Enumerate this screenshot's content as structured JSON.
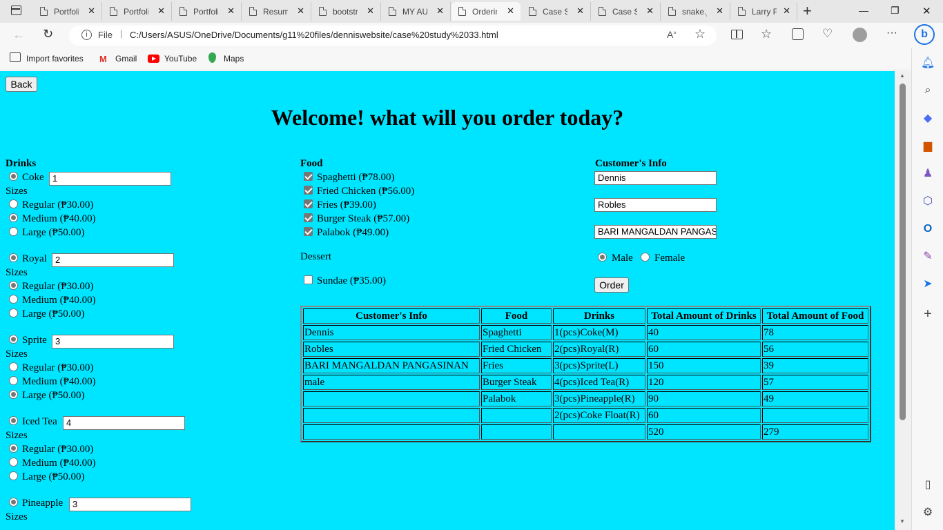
{
  "browser": {
    "tabs": [
      {
        "title": "Portfolio"
      },
      {
        "title": "Portfolio"
      },
      {
        "title": "Portfolio"
      },
      {
        "title": "Resume"
      },
      {
        "title": "bootstrap"
      },
      {
        "title": "MY AU"
      },
      {
        "title": "Ordering"
      },
      {
        "title": "Case Study"
      },
      {
        "title": "Case Study"
      },
      {
        "title": "snake.js"
      },
      {
        "title": "Larry P"
      }
    ],
    "file_label": "File",
    "url": "C:/Users/ASUS/OneDrive/Documents/g11%20files/denniswebsite/case%20study%2033.html",
    "favorites": [
      "Import favorites",
      "Gmail",
      "YouTube",
      "Maps"
    ]
  },
  "page": {
    "back_label": "Back",
    "heading": "Welcome! what will you order today?",
    "drinks_title": "Drinks",
    "sizes_label": "Sizes",
    "drinks": [
      {
        "name": "Coke",
        "qty": "1",
        "selected": true,
        "sizes": [
          {
            "label": "Regular (₱30.00)",
            "on": false
          },
          {
            "label": "Medium (₱40.00)",
            "on": true
          },
          {
            "label": "Large (₱50.00)",
            "on": false
          }
        ]
      },
      {
        "name": "Royal",
        "qty": "2",
        "selected": true,
        "sizes": [
          {
            "label": "Regular (₱30.00)",
            "on": true
          },
          {
            "label": "Medium (₱40.00)",
            "on": false
          },
          {
            "label": "Large (₱50.00)",
            "on": false
          }
        ]
      },
      {
        "name": "Sprite",
        "qty": "3",
        "selected": true,
        "sizes": [
          {
            "label": "Regular (₱30.00)",
            "on": false
          },
          {
            "label": "Medium (₱40.00)",
            "on": false
          },
          {
            "label": "Large (₱50.00)",
            "on": true
          }
        ]
      },
      {
        "name": "Iced Tea",
        "qty": "4",
        "selected": true,
        "sizes": [
          {
            "label": "Regular (₱30.00)",
            "on": true
          },
          {
            "label": "Medium (₱40.00)",
            "on": false
          },
          {
            "label": "Large (₱50.00)",
            "on": false
          }
        ]
      },
      {
        "name": "Pineapple",
        "qty": "3",
        "selected": true
      }
    ],
    "food_title": "Food",
    "foods": [
      {
        "label": "Spaghetti (₱78.00)",
        "checked": true
      },
      {
        "label": "Fried Chicken (₱56.00)",
        "checked": true
      },
      {
        "label": "Fries (₱39.00)",
        "checked": true
      },
      {
        "label": "Burger Steak (₱57.00)",
        "checked": true
      },
      {
        "label": "Palabok (₱49.00)",
        "checked": true
      }
    ],
    "dessert_title": "Dessert",
    "dessert": {
      "label": "Sundae (₱35.00)",
      "checked": false
    },
    "customer_title": "Customer's Info",
    "customer": {
      "first_name": "Dennis",
      "last_name": "Robles",
      "address": "BARI MANGALDAN PANGASINAN",
      "gender_male": "Male",
      "gender_female": "Female",
      "gender_selected": "Male"
    },
    "order_label": "Order",
    "table": {
      "headers": [
        "Customer's Info",
        "Food",
        "Drinks",
        "Total Amount of Drinks",
        "Total Amount of Food"
      ],
      "rows": [
        [
          "Dennis",
          "Spaghetti",
          "1(pcs)Coke(M)",
          "40",
          "78"
        ],
        [
          "Robles",
          "Fried Chicken",
          "2(pcs)Royal(R)",
          "60",
          "56"
        ],
        [
          "BARI MANGALDAN PANGASINAN",
          "Fries",
          "3(pcs)Sprite(L)",
          "150",
          "39"
        ],
        [
          "male",
          "Burger Steak",
          "4(pcs)Iced Tea(R)",
          "120",
          "57"
        ],
        [
          "",
          "Palabok",
          "3(pcs)Pineapple(R)",
          "90",
          "49"
        ],
        [
          "",
          "",
          "2(pcs)Coke Float(R)",
          "60",
          ""
        ],
        [
          "",
          "",
          "",
          "520",
          "279"
        ]
      ]
    }
  }
}
